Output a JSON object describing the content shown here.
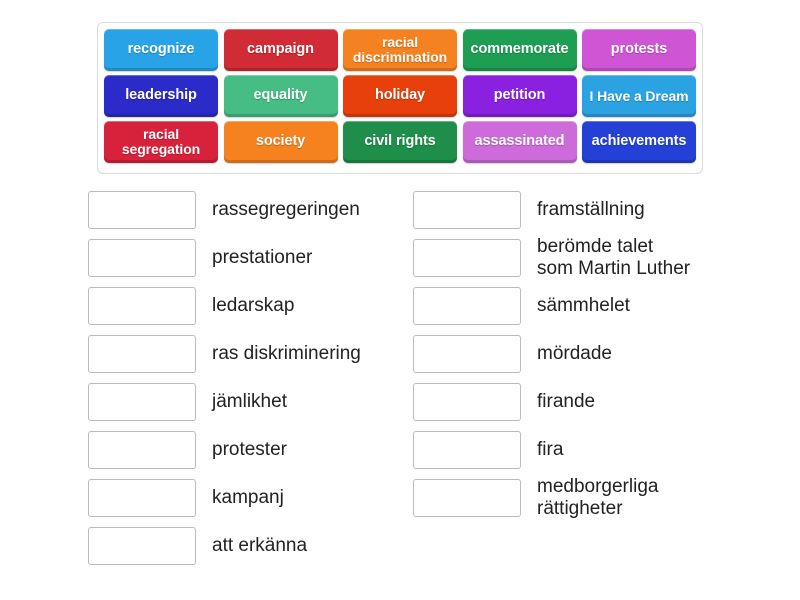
{
  "word_bank": {
    "rows": [
      [
        {
          "label": "recognize",
          "color": "#29A3E8",
          "two_line": false
        },
        {
          "label": "campaign",
          "color": "#D12B36",
          "two_line": false
        },
        {
          "label": "racial\ndiscrimination",
          "color": "#F58220",
          "two_line": true
        },
        {
          "label": "commemorate",
          "color": "#1E9E52",
          "two_line": false
        },
        {
          "label": "protests",
          "color": "#CE55D3",
          "two_line": false
        }
      ],
      [
        {
          "label": "leadership",
          "color": "#2B2BC9",
          "two_line": false
        },
        {
          "label": "equality",
          "color": "#45BD85",
          "two_line": false
        },
        {
          "label": "holiday",
          "color": "#E8400C",
          "two_line": false
        },
        {
          "label": "petition",
          "color": "#8B21E0",
          "two_line": false
        },
        {
          "label": "I Have a\nDream",
          "color": "#2BA3E3",
          "two_line": true
        }
      ],
      [
        {
          "label": "racial\nsegregation",
          "color": "#D8223C",
          "two_line": true
        },
        {
          "label": "society",
          "color": "#F5821F",
          "two_line": false
        },
        {
          "label": "civil rights",
          "color": "#1E8E4A",
          "two_line": false
        },
        {
          "label": "assassinated",
          "color": "#CE6BDB",
          "two_line": false
        },
        {
          "label": "achievements",
          "color": "#2540D6",
          "two_line": false
        }
      ]
    ]
  },
  "answers": {
    "left_column": [
      {
        "label": "rassegregeringen",
        "value": ""
      },
      {
        "label": "prestationer",
        "value": ""
      },
      {
        "label": "ledarskap",
        "value": ""
      },
      {
        "label": "ras diskriminering",
        "value": ""
      },
      {
        "label": "jämlikhet",
        "value": ""
      },
      {
        "label": "protester",
        "value": ""
      },
      {
        "label": "kampanj",
        "value": ""
      },
      {
        "label": "att erkänna",
        "value": ""
      }
    ],
    "right_column": [
      {
        "label": "framställning",
        "value": ""
      },
      {
        "label": "berömde talet\nsom Martin Luther",
        "value": ""
      },
      {
        "label": "sämmhelet",
        "value": ""
      },
      {
        "label": "mördade",
        "value": ""
      },
      {
        "label": "firande",
        "value": ""
      },
      {
        "label": "fira",
        "value": ""
      },
      {
        "label": "medborgerliga\nrättigheter",
        "value": ""
      }
    ]
  },
  "colors": {
    "panel_border": "#dcdcdc",
    "box_border": "#bcbcbc",
    "text": "#222222",
    "background": "#ffffff"
  }
}
